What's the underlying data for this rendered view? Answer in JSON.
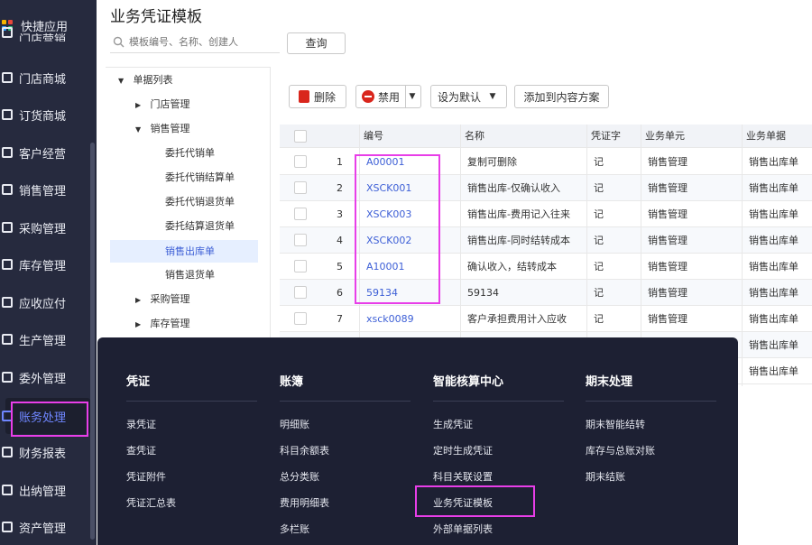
{
  "sidebar": {
    "items": [
      {
        "label": "快捷应用",
        "icon": "app-grid-icon"
      },
      {
        "label": "门店营销",
        "icon": "store-marketing-icon"
      },
      {
        "label": "门店商城",
        "icon": "store-mall-icon"
      },
      {
        "label": "订货商城",
        "icon": "order-mall-icon"
      },
      {
        "label": "客户经营",
        "icon": "customer-icon"
      },
      {
        "label": "销售管理",
        "icon": "sales-icon"
      },
      {
        "label": "采购管理",
        "icon": "purchase-icon"
      },
      {
        "label": "库存管理",
        "icon": "inventory-icon"
      },
      {
        "label": "应收应付",
        "icon": "receivable-icon"
      },
      {
        "label": "生产管理",
        "icon": "production-icon"
      },
      {
        "label": "委外管理",
        "icon": "outsource-icon"
      },
      {
        "label": "账务处理",
        "icon": "accounting-icon"
      },
      {
        "label": "财务报表",
        "icon": "report-icon"
      },
      {
        "label": "出纳管理",
        "icon": "cashier-icon"
      },
      {
        "label": "资产管理",
        "icon": "asset-icon"
      }
    ],
    "active_index": 11,
    "colors": {
      "bg": "#262a3e",
      "active_text": "#6f86ff"
    }
  },
  "header": {
    "title": "业务凭证模板",
    "search_placeholder": "模板编号、名称、创建人",
    "search_button": "查询"
  },
  "tree": {
    "root": "单据列表",
    "nodes": [
      {
        "label": "门店管理",
        "expanded": false
      },
      {
        "label": "销售管理",
        "expanded": true
      },
      {
        "label": "委托代销单"
      },
      {
        "label": "委托代销结算单"
      },
      {
        "label": "委托代销退货单"
      },
      {
        "label": "委托结算退货单"
      },
      {
        "label": "销售出库单",
        "selected": true
      },
      {
        "label": "销售退货单"
      },
      {
        "label": "采购管理",
        "expanded": false
      },
      {
        "label": "库存管理",
        "expanded": false
      }
    ]
  },
  "toolbar": {
    "delete": "删除",
    "disable": "禁用",
    "set_default": "设为默认",
    "add_to_plan": "添加到内容方案"
  },
  "table": {
    "columns": [
      "编号",
      "名称",
      "凭证字",
      "业务单元",
      "业务单据"
    ],
    "rows": [
      {
        "no": "1",
        "code": "A00001",
        "name": "复制可删除",
        "word": "记",
        "unit": "销售管理",
        "doc": "销售出库单"
      },
      {
        "no": "2",
        "code": "XSCK001",
        "name": "销售出库-仅确认收入",
        "word": "记",
        "unit": "销售管理",
        "doc": "销售出库单"
      },
      {
        "no": "3",
        "code": "XSCK003",
        "name": "销售出库-费用记入往来",
        "word": "记",
        "unit": "销售管理",
        "doc": "销售出库单"
      },
      {
        "no": "4",
        "code": "XSCK002",
        "name": "销售出库-同时结转成本",
        "word": "记",
        "unit": "销售管理",
        "doc": "销售出库单"
      },
      {
        "no": "5",
        "code": "A10001",
        "name": "确认收入，结转成本",
        "word": "记",
        "unit": "销售管理",
        "doc": "销售出库单"
      },
      {
        "no": "6",
        "code": "59134",
        "name": "59134",
        "word": "记",
        "unit": "销售管理",
        "doc": "销售出库单"
      },
      {
        "no": "7",
        "code": "xsck0089",
        "name": "客户承担费用计入应收",
        "word": "记",
        "unit": "销售管理",
        "doc": "销售出库单"
      },
      {
        "no": "",
        "code": "",
        "name": "",
        "word": "",
        "unit": "",
        "doc": "销售出库单"
      },
      {
        "no": "",
        "code": "",
        "name": "",
        "word": "",
        "unit": "",
        "doc": "销售出库单"
      }
    ]
  },
  "flyout": {
    "columns": [
      {
        "title": "凭证",
        "items": [
          "录凭证",
          "查凭证",
          "凭证附件",
          "凭证汇总表"
        ]
      },
      {
        "title": "账簿",
        "items": [
          "明细账",
          "科目余额表",
          "总分类账",
          "费用明细表",
          "多栏账"
        ]
      },
      {
        "title": "智能核算中心",
        "items": [
          "生成凭证",
          "定时生成凭证",
          "科目关联设置",
          "业务凭证模板",
          "外部单据列表"
        ]
      },
      {
        "title": "期末处理",
        "items": [
          "期末智能结转",
          "库存与总账对账",
          "期末结账"
        ]
      }
    ],
    "highlighted_item": "业务凭证模板"
  }
}
